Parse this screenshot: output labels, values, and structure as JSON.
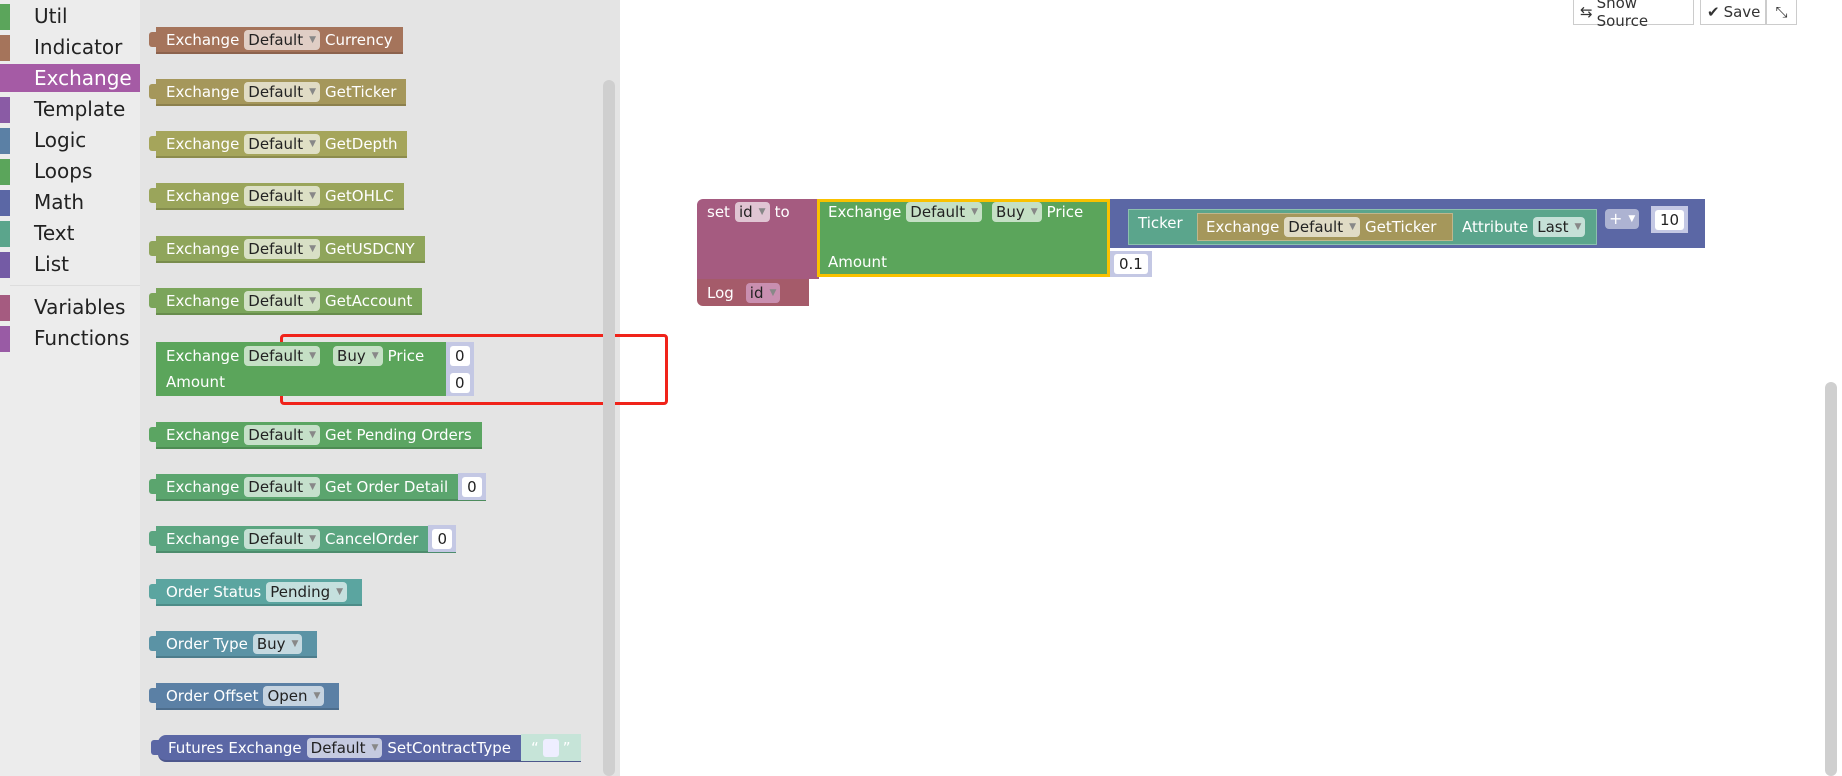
{
  "toolbox": {
    "categories": [
      {
        "label": "Util",
        "color": "#5ba55b"
      },
      {
        "label": "Indicator",
        "color": "#a5745b"
      },
      {
        "label": "Exchange",
        "color": "#a55ba5",
        "selected": true
      },
      {
        "label": "Template",
        "color": "#8a5ba5"
      },
      {
        "label": "Logic",
        "color": "#5b80a5"
      },
      {
        "label": "Loops",
        "color": "#5ba55b"
      },
      {
        "label": "Math",
        "color": "#5b67a5"
      },
      {
        "label": "Text",
        "color": "#5ba58c"
      },
      {
        "label": "List",
        "color": "#745ba5"
      },
      {
        "label": "Variables",
        "color": "#a55b80"
      },
      {
        "label": "Functions",
        "color": "#995ba5"
      }
    ]
  },
  "flyout": {
    "blocks": [
      {
        "prefix": "Exchange",
        "field": "Default",
        "suffix": "Currency",
        "color": "#a5745b"
      },
      {
        "prefix": "Exchange",
        "field": "Default",
        "suffix": "GetTicker",
        "color": "#a5975b"
      },
      {
        "prefix": "Exchange",
        "field": "Default",
        "suffix": "GetDepth",
        "color": "#a5a55b"
      },
      {
        "prefix": "Exchange",
        "field": "Default",
        "suffix": "GetOHLC",
        "color": "#9aa55b"
      },
      {
        "prefix": "Exchange",
        "field": "Default",
        "suffix": "GetUSDCNY",
        "color": "#8fa55b"
      },
      {
        "prefix": "Exchange",
        "field": "Default",
        "suffix": "GetAccount",
        "color": "#7ba55b"
      },
      {
        "prefix": "Exchange",
        "field": "Default",
        "suffix": "Get Pending Orders",
        "color": "#5ba562"
      },
      {
        "prefix": "Exchange",
        "field": "Default",
        "suffix": "Get Order Detail",
        "color": "#5ba56e",
        "input": "0"
      },
      {
        "prefix": "Exchange",
        "field": "Default",
        "suffix": "CancelOrder",
        "color": "#5ba580",
        "input": "0"
      },
      {
        "prefix": "Order Status",
        "field": "Pending",
        "suffix": "",
        "color": "#5ba5a0"
      },
      {
        "prefix": "Order Type",
        "field": "Buy",
        "suffix": "",
        "color": "#5b93a5"
      },
      {
        "prefix": "Order Offset",
        "field": "Open",
        "suffix": "",
        "color": "#5b80a5"
      },
      {
        "prefix": "Futures Exchange",
        "field": "Default",
        "suffix": "SetContractType",
        "color": "#5b67a5"
      }
    ],
    "buy_block": {
      "prefix": "Exchange",
      "field": "Default",
      "side": "Buy",
      "price_label": "Price",
      "amount_label": "Amount",
      "price": "0",
      "amount": "0",
      "color": "#5ba55b"
    },
    "string_quotes": {
      "open": "“",
      "close": "”"
    }
  },
  "workspace": {
    "set_block": {
      "label_set": "set",
      "var": "id",
      "label_to": "to",
      "color": "#a55b80"
    },
    "buy_block": {
      "prefix": "Exchange",
      "field": "Default",
      "side": "Buy",
      "price_label": "Price",
      "amount_label": "Amount",
      "amount": "0.1"
    },
    "math_block": {
      "op": "+",
      "value": "10",
      "color": "#5b67a5"
    },
    "ticker_block": {
      "label": "Ticker",
      "attr_label": "Attribute",
      "attr": "Last",
      "color": "#5ba58c"
    },
    "getticker_block": {
      "prefix": "Exchange",
      "field": "Default",
      "suffix": "GetTicker"
    },
    "log_block": {
      "label": "Log",
      "var": "id",
      "color": "#a55b6a"
    }
  },
  "toolbar": {
    "show_source": "Show Source",
    "save": "Save"
  }
}
